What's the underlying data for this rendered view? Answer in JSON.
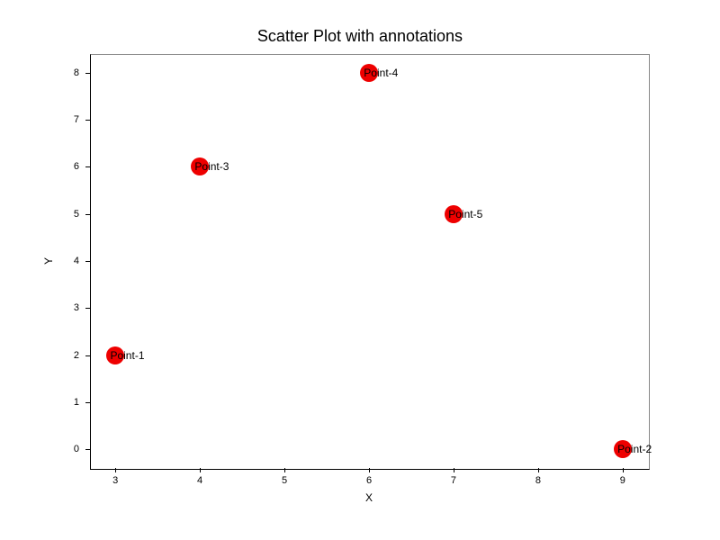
{
  "chart_data": {
    "type": "scatter",
    "title": "Scatter Plot with annotations",
    "xlabel": "X",
    "ylabel": "Y",
    "xlim": [
      2.7,
      9.3
    ],
    "ylim": [
      -0.4,
      8.4
    ],
    "x_ticks": [
      3,
      4,
      5,
      6,
      7,
      8,
      9
    ],
    "y_ticks": [
      0,
      1,
      2,
      3,
      4,
      5,
      6,
      7,
      8
    ],
    "points": [
      {
        "x": 3,
        "y": 2,
        "label": "Point-1"
      },
      {
        "x": 9,
        "y": 0,
        "label": "Point-2"
      },
      {
        "x": 4,
        "y": 6,
        "label": "Point-3"
      },
      {
        "x": 6,
        "y": 8,
        "label": "Point-4"
      },
      {
        "x": 7,
        "y": 5,
        "label": "Point-5"
      }
    ],
    "color": "#ee0000"
  }
}
